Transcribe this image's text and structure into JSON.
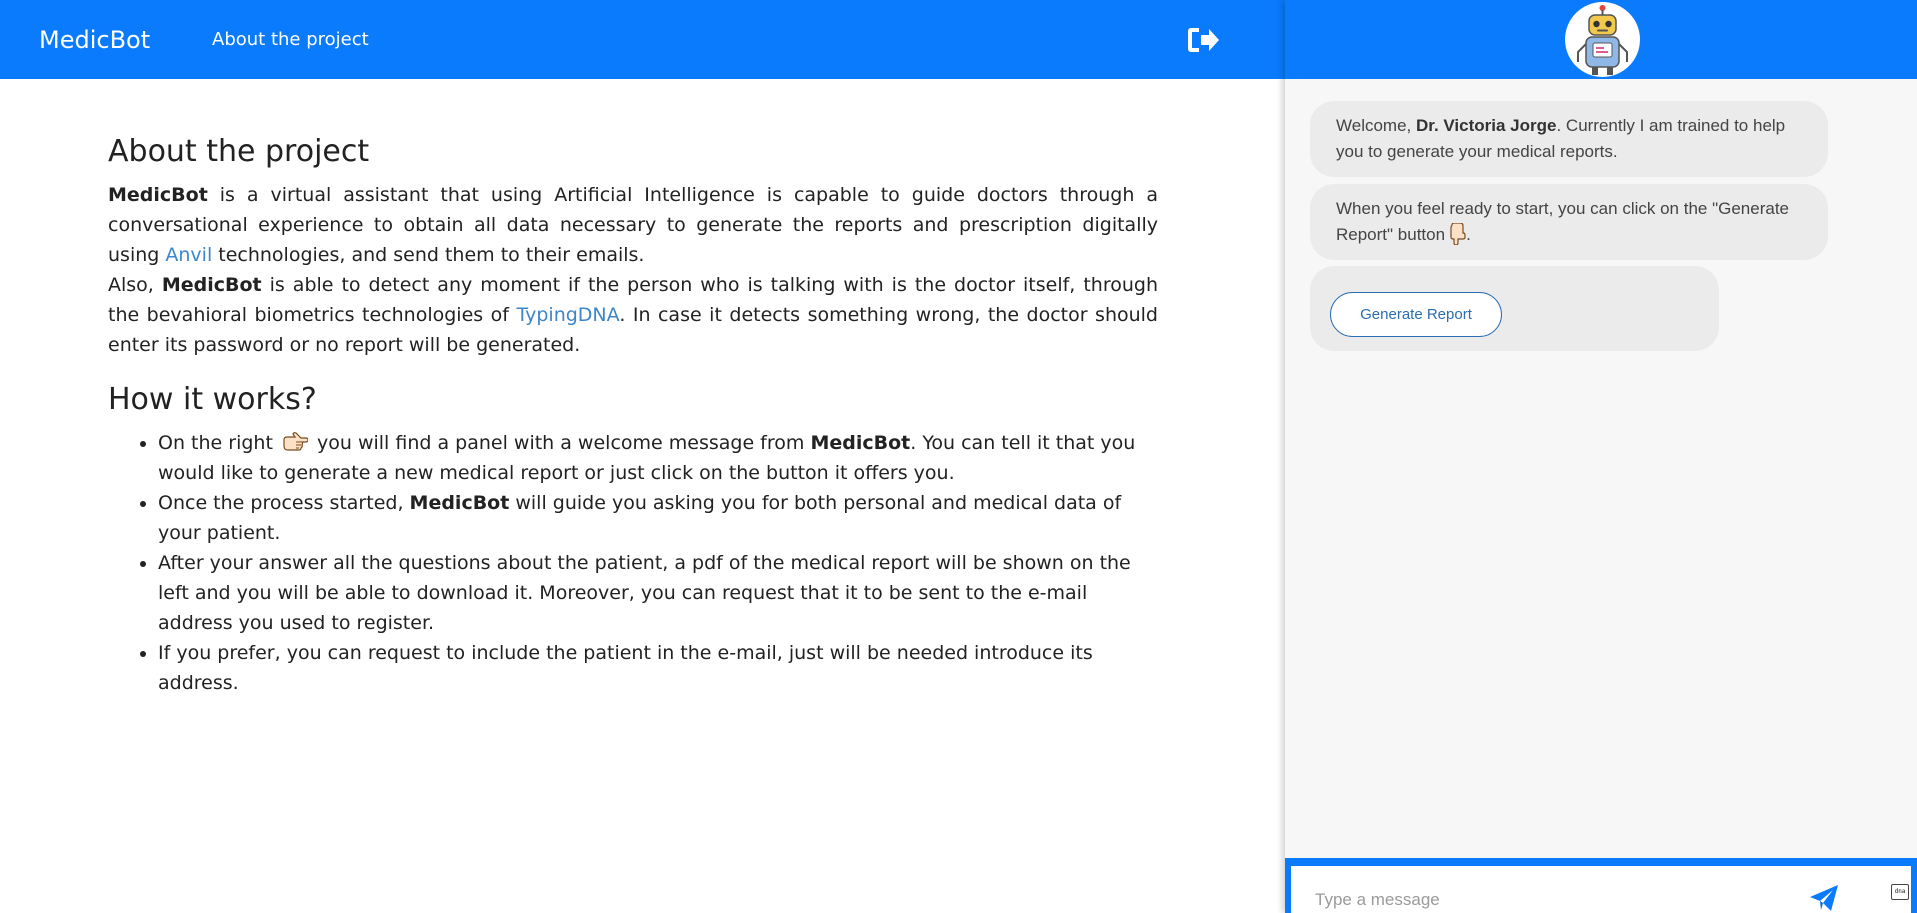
{
  "navbar": {
    "brand": "MedicBot",
    "about_link": "About the project",
    "logout_icon": "sign-out-icon"
  },
  "content": {
    "heading1": "About the project",
    "p1": {
      "bold": "MedicBot",
      "text1": " is a virtual assistant that using Artificial Intelligence is capable to guide doctors through a conversational experience to obtain all data necessary to generate the reports and prescription digitally using ",
      "link": "Anvil",
      "text2": " technologies, and send them to their emails."
    },
    "p2": {
      "text1": "Also, ",
      "bold": "MedicBot",
      "text2": " is able to detect any moment if the person who is talking with is the doctor itself, through the bevahioral biometrics technologies of ",
      "link": "TypingDNA",
      "text3": ". In case it detects something wrong, the doctor should enter its password or no report will be generated."
    },
    "heading2": "How it works?",
    "bullets": {
      "b1": {
        "text1": "On the right ",
        "text2": " you will find a panel with a welcome message from ",
        "bold": "MedicBot",
        "text3": ". You can tell it that you would like to generate a new medical report or just click on the button it offers you."
      },
      "b2": {
        "text1": "Once the process started, ",
        "bold": "MedicBot",
        "text2": " will guide you asking you for both personal and medical data of your patient."
      },
      "b3": "After your answer all the questions about the patient, a pdf of the medical report will be shown on the left and you will be able to download it. Moreover, you can request that it to be sent to the e-mail address you used to register.",
      "b4": "If you prefer, you can request to include the patient in the e-mail, just will be needed introduce its address."
    }
  },
  "chat": {
    "avatar_icon": "robot-icon",
    "msg1": {
      "text1": "Welcome, ",
      "bold": "Dr. Victoria Jorge",
      "text2": ". Currently I am trained to help you to generate your medical reports."
    },
    "msg2": {
      "text1": "When you feel ready to start, you can click on the \"Generate Report\" button",
      "text2": "."
    },
    "button_label": "Generate Report",
    "input_placeholder": "Type a message",
    "dna_badge": "dna"
  },
  "colors": {
    "primary": "#0a7bfd",
    "link": "#3d86c9",
    "bubble": "#ebebeb",
    "panel": "#f7f7f7"
  }
}
